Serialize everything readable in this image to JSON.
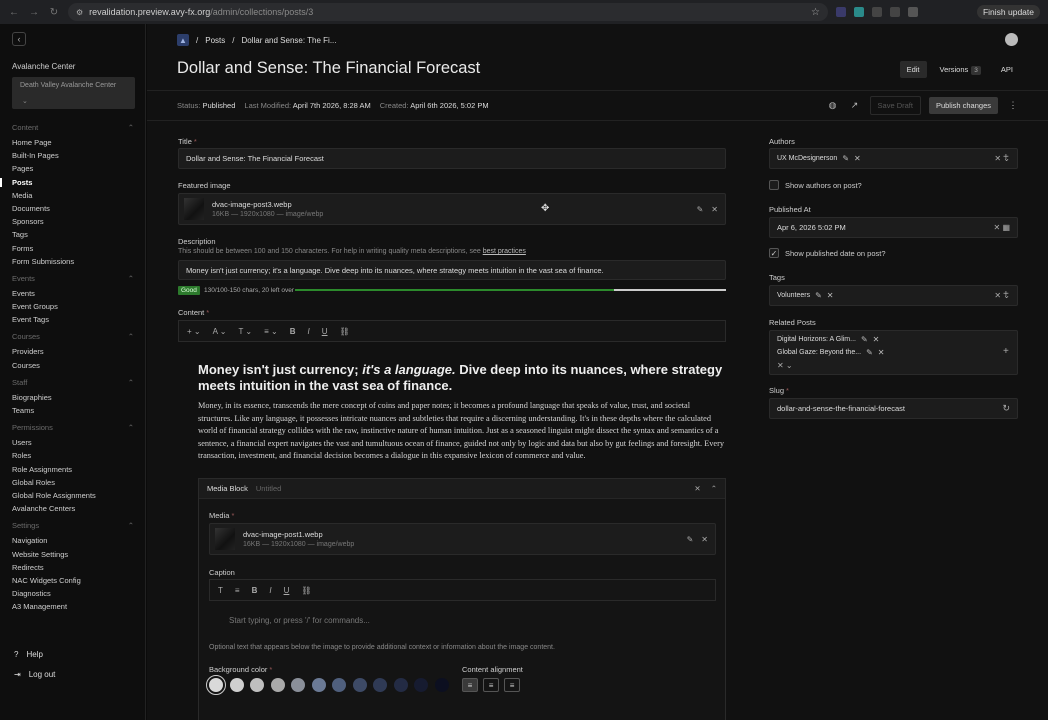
{
  "browser": {
    "url_host": "revalidation.preview.avy-fx.org",
    "url_path": "/admin/collections/posts/3",
    "finish_update": "Finish update"
  },
  "sidebar": {
    "tenant_label": "Avalanche Center",
    "tenant_value": "Death Valley Avalanche Center",
    "groups": [
      {
        "title": "Content",
        "items": [
          "Home Page",
          "Built-In Pages",
          "Pages",
          "Posts",
          "Media",
          "Documents",
          "Sponsors",
          "Tags",
          "Forms",
          "Form Submissions"
        ]
      },
      {
        "title": "Events",
        "items": [
          "Events",
          "Event Groups",
          "Event Tags"
        ]
      },
      {
        "title": "Courses",
        "items": [
          "Providers",
          "Courses"
        ]
      },
      {
        "title": "Staff",
        "items": [
          "Biographies",
          "Teams"
        ]
      },
      {
        "title": "Permissions",
        "items": [
          "Users",
          "Roles",
          "Role Assignments",
          "Global Roles",
          "Global Role Assignments",
          "Avalanche Centers"
        ]
      },
      {
        "title": "Settings",
        "items": [
          "Navigation",
          "Website Settings",
          "Redirects",
          "NAC Widgets Config",
          "Diagnostics",
          "A3 Management"
        ]
      }
    ],
    "active_item": "Posts",
    "help": "Help",
    "logout": "Log out"
  },
  "breadcrumb": {
    "section": "Posts",
    "current": "Dollar and Sense: The Fi..."
  },
  "header": {
    "title": "Dollar and Sense: The Financial Forecast",
    "tabs": {
      "edit": "Edit",
      "versions": "Versions",
      "versions_count": "3",
      "api": "API"
    }
  },
  "meta": {
    "status_label": "Status:",
    "status": "Published",
    "modified_label": "Last Modified:",
    "modified": "April 7th 2026, 8:28 AM",
    "created_label": "Created:",
    "created": "April 6th 2026, 5:02 PM",
    "save_draft": "Save Draft",
    "publish": "Publish changes"
  },
  "form": {
    "title_label": "Title",
    "title_value": "Dollar and Sense: The Financial Forecast",
    "featured_label": "Featured image",
    "featured_file": "dvac-image-post3.webp",
    "featured_meta": "16KB — 1920x1080 — image/webp",
    "description_label": "Description",
    "description_help": "This should be between 100 and 150 characters. For help in writing quality meta descriptions, see",
    "description_help_link": "best practices",
    "description_value": "Money isn't just currency; it's a language. Dive deep into its nuances, where strategy meets intuition in the vast sea of finance.",
    "description_status": "Good",
    "description_count": "130/100-150 chars, 20 left over",
    "description_fill": 0.74,
    "content_label": "Content",
    "heading_start": "Money isn't just currency;",
    "heading_italic": "it's a language.",
    "heading_end": "Dive deep into its nuances, where strategy meets intuition in the vast sea of finance.",
    "body": "Money, in its essence, transcends the mere concept of coins and paper notes; it becomes a profound language that speaks of value, trust, and societal structures. Like any language, it possesses intricate nuances and subtleties that require a discerning understanding. It's in these depths where the calculated world of financial strategy collides with the raw, instinctive nature of human intuition. Just as a seasoned linguist might dissect the syntax and semantics of a sentence, a financial expert navigates the vast and tumultuous ocean of finance, guided not only by logic and data but also by gut feelings and foresight. Every transaction, investment, and financial decision becomes a dialogue in this expansive lexicon of commerce and value."
  },
  "media_block": {
    "title": "Media Block",
    "subtitle": "Untitled",
    "media_label": "Media",
    "file": "dvac-image-post1.webp",
    "file_meta": "16KB — 1920x1080 — image/webp",
    "caption_label": "Caption",
    "caption_placeholder": "Start typing, or press '/' for commands...",
    "caption_help": "Optional text that appears below the image to provide additional context or information about the image content.",
    "bg_label": "Background color",
    "align_label": "Content alignment",
    "swatches": [
      "#d9d9d9",
      "#cfcfcf",
      "#bfbfbf",
      "#a9a9a9",
      "#8a8f99",
      "#6b7a95",
      "#4f5f7d",
      "#3d4a66",
      "#2f3a55",
      "#232b44",
      "#161b30",
      "#0c0f20"
    ]
  },
  "right": {
    "authors_label": "Authors",
    "author": "UX McDesignerson",
    "show_authors": "Show authors on post?",
    "published_label": "Published At",
    "published_value": "Apr 6, 2026 5:02 PM",
    "show_published": "Show published date on post?",
    "tags_label": "Tags",
    "tag": "Volunteers",
    "related_label": "Related Posts",
    "related": [
      "Digital Horizons: A Glim...",
      "Global Gaze: Beyond the..."
    ],
    "slug_label": "Slug",
    "slug_value": "dollar-and-sense-the-financial-forecast"
  }
}
